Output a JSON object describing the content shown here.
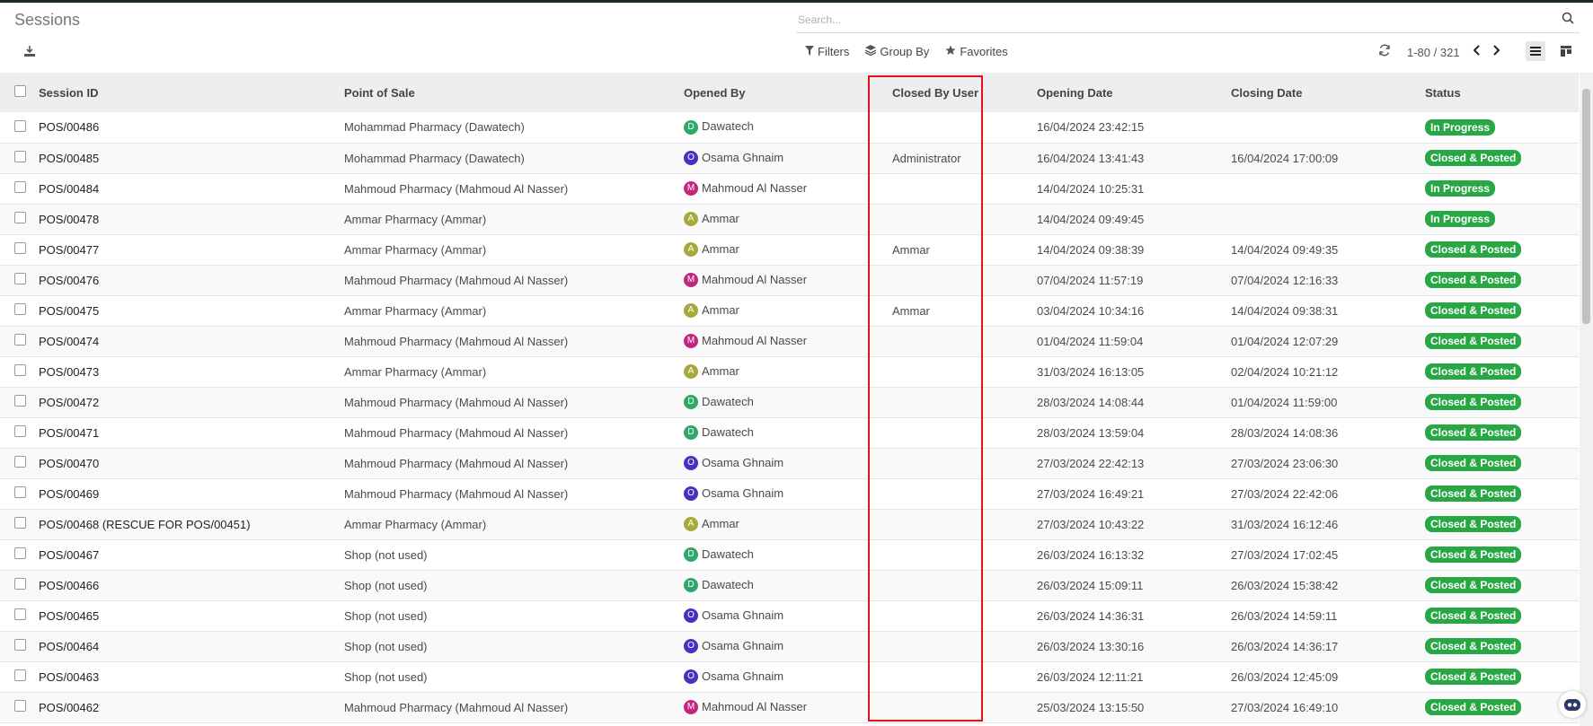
{
  "page": {
    "title": "Sessions"
  },
  "search": {
    "placeholder": "Search..."
  },
  "toolbar": {
    "filters_label": "Filters",
    "groupby_label": "Group By",
    "favorites_label": "Favorites",
    "pager_text": "1-80 / 321"
  },
  "table": {
    "headers": {
      "session_id": "Session ID",
      "point_of_sale": "Point of Sale",
      "opened_by": "Opened By",
      "closed_by_user": "Closed By User",
      "opening_date": "Opening Date",
      "closing_date": "Closing Date",
      "status": "Status"
    },
    "rows": [
      {
        "id": "POS/00486",
        "pos": "Mohammad Pharmacy (Dawatech)",
        "initial": "D",
        "opened_by": "Dawatech",
        "closed_by": "",
        "open": "16/04/2024 23:42:15",
        "close": "",
        "status": "In Progress"
      },
      {
        "id": "POS/00485",
        "pos": "Mohammad Pharmacy (Dawatech)",
        "initial": "O",
        "opened_by": "Osama Ghnaim",
        "closed_by": "Administrator",
        "open": "16/04/2024 13:41:43",
        "close": "16/04/2024 17:00:09",
        "status": "Closed & Posted"
      },
      {
        "id": "POS/00484",
        "pos": "Mahmoud Pharmacy (Mahmoud Al Nasser)",
        "initial": "M",
        "opened_by": "Mahmoud Al Nasser",
        "closed_by": "",
        "open": "14/04/2024 10:25:31",
        "close": "",
        "status": "In Progress"
      },
      {
        "id": "POS/00478",
        "pos": "Ammar Pharmacy (Ammar)",
        "initial": "A",
        "opened_by": "Ammar",
        "closed_by": "",
        "open": "14/04/2024 09:49:45",
        "close": "",
        "status": "In Progress"
      },
      {
        "id": "POS/00477",
        "pos": "Ammar Pharmacy (Ammar)",
        "initial": "A",
        "opened_by": "Ammar",
        "closed_by": "Ammar",
        "open": "14/04/2024 09:38:39",
        "close": "14/04/2024 09:49:35",
        "status": "Closed & Posted"
      },
      {
        "id": "POS/00476",
        "pos": "Mahmoud Pharmacy (Mahmoud Al Nasser)",
        "initial": "M",
        "opened_by": "Mahmoud Al Nasser",
        "closed_by": "",
        "open": "07/04/2024 11:57:19",
        "close": "07/04/2024 12:16:33",
        "status": "Closed & Posted"
      },
      {
        "id": "POS/00475",
        "pos": "Ammar Pharmacy (Ammar)",
        "initial": "A",
        "opened_by": "Ammar",
        "closed_by": "Ammar",
        "open": "03/04/2024 10:34:16",
        "close": "14/04/2024 09:38:31",
        "status": "Closed & Posted"
      },
      {
        "id": "POS/00474",
        "pos": "Mahmoud Pharmacy (Mahmoud Al Nasser)",
        "initial": "M",
        "opened_by": "Mahmoud Al Nasser",
        "closed_by": "",
        "open": "01/04/2024 11:59:04",
        "close": "01/04/2024 12:07:29",
        "status": "Closed & Posted"
      },
      {
        "id": "POS/00473",
        "pos": "Ammar Pharmacy (Ammar)",
        "initial": "A",
        "opened_by": "Ammar",
        "closed_by": "",
        "open": "31/03/2024 16:13:05",
        "close": "02/04/2024 10:21:12",
        "status": "Closed & Posted"
      },
      {
        "id": "POS/00472",
        "pos": "Mahmoud Pharmacy (Mahmoud Al Nasser)",
        "initial": "D",
        "opened_by": "Dawatech",
        "closed_by": "",
        "open": "28/03/2024 14:08:44",
        "close": "01/04/2024 11:59:00",
        "status": "Closed & Posted"
      },
      {
        "id": "POS/00471",
        "pos": "Mahmoud Pharmacy (Mahmoud Al Nasser)",
        "initial": "D",
        "opened_by": "Dawatech",
        "closed_by": "",
        "open": "28/03/2024 13:59:04",
        "close": "28/03/2024 14:08:36",
        "status": "Closed & Posted"
      },
      {
        "id": "POS/00470",
        "pos": "Mahmoud Pharmacy (Mahmoud Al Nasser)",
        "initial": "O",
        "opened_by": "Osama Ghnaim",
        "closed_by": "",
        "open": "27/03/2024 22:42:13",
        "close": "27/03/2024 23:06:30",
        "status": "Closed & Posted"
      },
      {
        "id": "POS/00469",
        "pos": "Mahmoud Pharmacy (Mahmoud Al Nasser)",
        "initial": "O",
        "opened_by": "Osama Ghnaim",
        "closed_by": "",
        "open": "27/03/2024 16:49:21",
        "close": "27/03/2024 22:42:06",
        "status": "Closed & Posted"
      },
      {
        "id": "POS/00468 (RESCUE FOR POS/00451)",
        "pos": "Ammar Pharmacy (Ammar)",
        "initial": "A",
        "opened_by": "Ammar",
        "closed_by": "",
        "open": "27/03/2024 10:43:22",
        "close": "31/03/2024 16:12:46",
        "status": "Closed & Posted"
      },
      {
        "id": "POS/00467",
        "pos": "Shop (not used)",
        "initial": "D",
        "opened_by": "Dawatech",
        "closed_by": "",
        "open": "26/03/2024 16:13:32",
        "close": "27/03/2024 17:02:45",
        "status": "Closed & Posted"
      },
      {
        "id": "POS/00466",
        "pos": "Shop (not used)",
        "initial": "D",
        "opened_by": "Dawatech",
        "closed_by": "",
        "open": "26/03/2024 15:09:11",
        "close": "26/03/2024 15:38:42",
        "status": "Closed & Posted"
      },
      {
        "id": "POS/00465",
        "pos": "Shop (not used)",
        "initial": "O",
        "opened_by": "Osama Ghnaim",
        "closed_by": "",
        "open": "26/03/2024 14:36:31",
        "close": "26/03/2024 14:59:11",
        "status": "Closed & Posted"
      },
      {
        "id": "POS/00464",
        "pos": "Shop (not used)",
        "initial": "O",
        "opened_by": "Osama Ghnaim",
        "closed_by": "",
        "open": "26/03/2024 13:30:16",
        "close": "26/03/2024 14:36:17",
        "status": "Closed & Posted"
      },
      {
        "id": "POS/00463",
        "pos": "Shop (not used)",
        "initial": "O",
        "opened_by": "Osama Ghnaim",
        "closed_by": "",
        "open": "26/03/2024 12:11:21",
        "close": "26/03/2024 12:45:09",
        "status": "Closed & Posted"
      },
      {
        "id": "POS/00462",
        "pos": "Mahmoud Pharmacy (Mahmoud Al Nasser)",
        "initial": "M",
        "opened_by": "Mahmoud Al Nasser",
        "closed_by": "",
        "open": "25/03/2024 13:15:50",
        "close": "27/03/2024 16:49:10",
        "status": "Closed & Posted"
      }
    ]
  },
  "colors": {
    "avatar_D": "#2ea86a",
    "avatar_O": "#4a2fc1",
    "avatar_M": "#c2277e",
    "avatar_A": "#a7a93a",
    "status_green": "#28a745",
    "highlight_red": "#e8121b"
  },
  "icons": {
    "download": "download-icon",
    "search": "search-icon",
    "filter": "filter-icon",
    "groupby": "layers-icon",
    "favorites": "star-icon",
    "refresh": "refresh-icon",
    "prev": "chevron-left-icon",
    "next": "chevron-right-icon",
    "list_view": "list-view-icon",
    "kanban_view": "kanban-view-icon"
  }
}
